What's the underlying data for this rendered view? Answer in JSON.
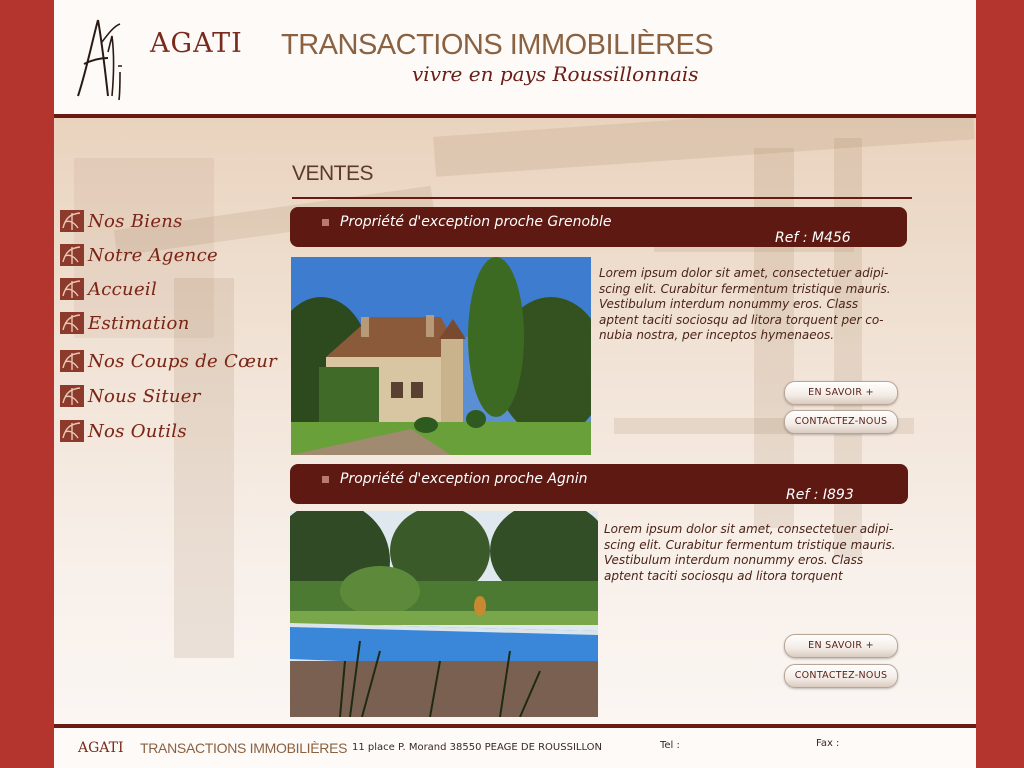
{
  "header": {
    "brand_bold": "AGATI",
    "brand_rest": "TRANSACTIONS IMMOBILIÈRES",
    "tagline": "vivre en pays Roussillonnais"
  },
  "nav": {
    "items": [
      {
        "label": "Nos Biens"
      },
      {
        "label": "Notre Agence"
      },
      {
        "label": "Accueil"
      },
      {
        "label": "Estimation"
      },
      {
        "label": "Nos Coups de Cœur"
      },
      {
        "label": "Nous Situer"
      },
      {
        "label": "Nos Outils"
      }
    ]
  },
  "main": {
    "section_title": "VENTES",
    "listings": [
      {
        "title": "Propriété d'exception proche Grenoble",
        "ref": "Ref : M456",
        "photo_icon": "manor-house-photo",
        "description_lines": [
          "Lorem ipsum dolor sit amet, consectetuer adipi-",
          "scing elit. Curabitur fermentum tristique mauris.",
          "Vestibulum interdum nonummy eros. Class",
          "aptent taciti sociosqu ad litora torquent per co-",
          "nubia nostra, per inceptos hymenaeos."
        ],
        "more_label": "EN SAVOIR +",
        "contact_label": "CONTACTEZ-NOUS"
      },
      {
        "title": "Propriété d'exception proche Agnin",
        "ref": "Ref : I893",
        "photo_icon": "garden-pool-photo",
        "description_lines": [
          "Lorem ipsum dolor sit amet, consectetuer adipi-",
          "scing elit. Curabitur fermentum tristique mauris.",
          "Vestibulum interdum nonummy eros. Class",
          "aptent taciti sociosqu ad litora torquent"
        ],
        "more_label": "EN SAVOIR +",
        "contact_label": "CONTACTEZ-NOUS"
      }
    ]
  },
  "footer": {
    "brand_bold": "AGATI",
    "brand_rest": "TRANSACTIONS IMMOBILIÈRES",
    "address": "11 place P. Morand  38550 PEAGE DE ROUSSILLON",
    "tel_label": "Tel :",
    "fax_label": "Fax :"
  },
  "colors": {
    "frame": "#b3352d",
    "accent_dark": "#5e1a12",
    "nav_text": "#7a2418"
  }
}
